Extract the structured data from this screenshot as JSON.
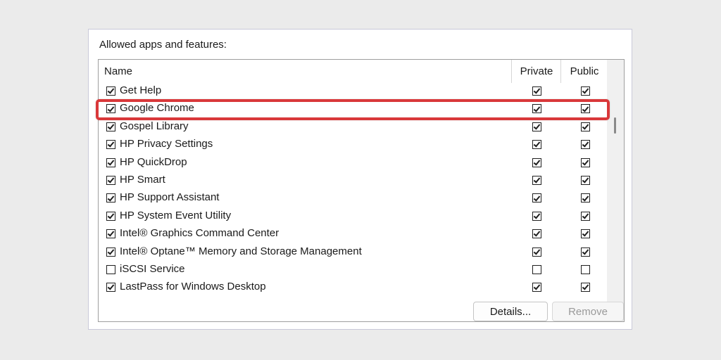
{
  "section_label": "Allowed apps and features:",
  "columns": {
    "name": "Name",
    "private": "Private",
    "public": "Public"
  },
  "rows": [
    {
      "label": "Get Help",
      "enabled": true,
      "private": true,
      "public": true
    },
    {
      "label": "Google Chrome",
      "enabled": true,
      "private": true,
      "public": true
    },
    {
      "label": "Gospel Library",
      "enabled": true,
      "private": true,
      "public": true
    },
    {
      "label": "HP Privacy Settings",
      "enabled": true,
      "private": true,
      "public": true
    },
    {
      "label": "HP QuickDrop",
      "enabled": true,
      "private": true,
      "public": true
    },
    {
      "label": "HP Smart",
      "enabled": true,
      "private": true,
      "public": true
    },
    {
      "label": "HP Support Assistant",
      "enabled": true,
      "private": true,
      "public": true
    },
    {
      "label": "HP System Event Utility",
      "enabled": true,
      "private": true,
      "public": true
    },
    {
      "label": "Intel® Graphics Command Center",
      "enabled": true,
      "private": true,
      "public": true
    },
    {
      "label": "Intel® Optane™ Memory and Storage Management",
      "enabled": true,
      "private": true,
      "public": true
    },
    {
      "label": "iSCSI Service",
      "enabled": false,
      "private": false,
      "public": false
    },
    {
      "label": "LastPass for Windows Desktop",
      "enabled": true,
      "private": true,
      "public": true
    }
  ],
  "highlighted_row": "Google Chrome",
  "buttons": {
    "details": "Details...",
    "remove": "Remove"
  },
  "colors": {
    "highlight": "#d9383a",
    "background": "#ebebeb"
  }
}
